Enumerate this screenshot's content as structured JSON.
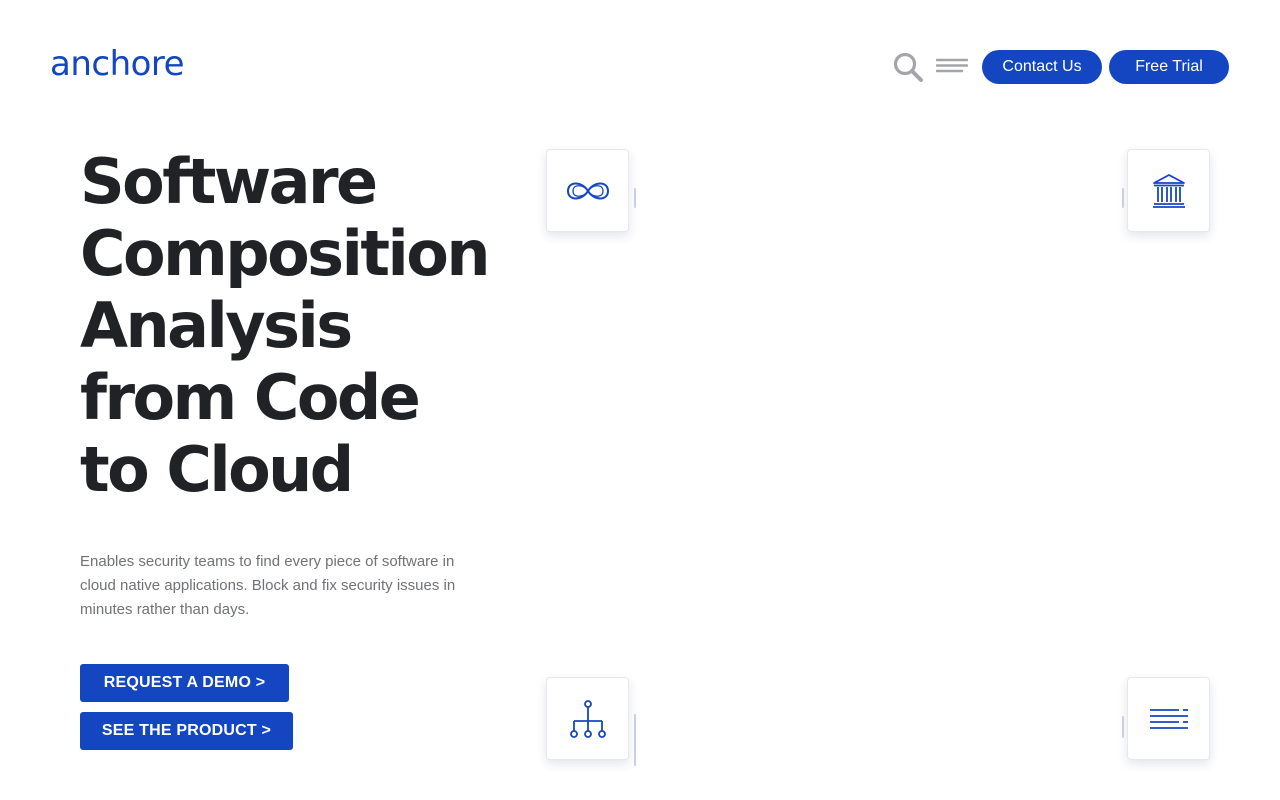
{
  "brand": {
    "logo_text": "anchore",
    "color": "#1446c2"
  },
  "nav": {
    "search_icon": "search-icon",
    "menu_icon": "hamburger-menu-icon",
    "contact_label": "Contact Us",
    "trial_label": "Free Trial"
  },
  "hero": {
    "headline_lines": [
      "Software",
      "Composition",
      "Analysis",
      "from Code",
      "to Cloud"
    ],
    "subtext": "Enables security teams to find every piece of software in cloud native applications. Block and fix security issues in minutes rather than days.",
    "demo_label": "REQUEST A DEMO >",
    "product_label": "SEE THE PRODUCT >"
  },
  "feature_cards": [
    {
      "icon": "infinity-icon"
    },
    {
      "icon": "government-building-icon"
    },
    {
      "icon": "hierarchy-tree-icon"
    },
    {
      "icon": "lines-list-icon"
    }
  ],
  "colors": {
    "accent": "#1446c2",
    "headline": "#202226",
    "body_text": "#707277"
  }
}
